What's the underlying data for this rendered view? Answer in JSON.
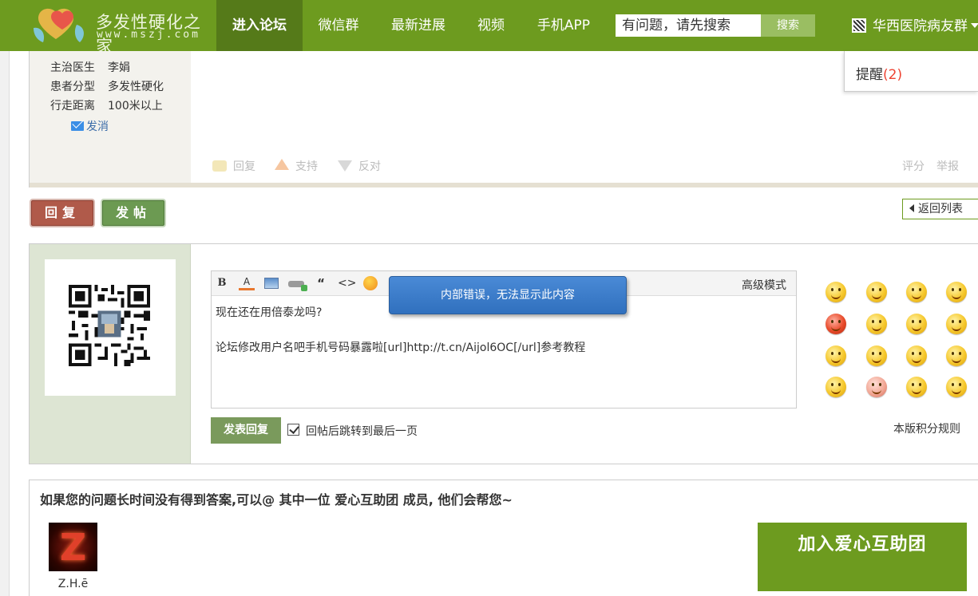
{
  "colors": {
    "brand_green": "#6d9b1f",
    "nav_active": "#557a19",
    "reply_red": "#b05a4a",
    "post_green": "#6c9a52",
    "error_blue": "#3a7bc8"
  },
  "header": {
    "logo_cn": "多发性硬化之家",
    "logo_url": "www.mszj.com",
    "nav": [
      "进入论坛",
      "微信群",
      "最新进展",
      "视频",
      "手机APP"
    ],
    "search": {
      "value": "有问题，请先搜索",
      "button": "搜索"
    },
    "group_link": "华西医院病友群",
    "reminder": {
      "label": "提醒",
      "count": "(2)"
    }
  },
  "post": {
    "profile": [
      {
        "label": "主治医生",
        "value": "李娟"
      },
      {
        "label": "患者分型",
        "value": "多发性硬化"
      },
      {
        "label": "行走距离",
        "value": "100米以上"
      }
    ],
    "send_message": "发消",
    "actions": {
      "reply": "回复",
      "support": "支持",
      "oppose": "反对",
      "rate": "评分",
      "report": "举报"
    }
  },
  "buttons": {
    "reply": "回复",
    "new_post": "发帖",
    "back_to_list": "返回列表"
  },
  "editor": {
    "advanced_mode": "高级模式",
    "lines": [
      "现在还在用倍泰龙吗?",
      "",
      "论坛修改用户名吧手机号码暴露啦[url]http://t.cn/Aijol6OC[/url]参考教程"
    ],
    "error_popup": "内部错误，无法显示此内容",
    "submit": "发表回复",
    "jump_option": "回帖后跳转到最后一页",
    "jump_checked": true,
    "rules_link": "本版积分规则"
  },
  "help": {
    "title": "如果您的问题长时间没有得到答案,可以@ 其中一位 爱心互助团 成员, 他们会帮您~",
    "members": [
      {
        "name": "Z.H.ē"
      }
    ],
    "join_button": "加入爱心互助团"
  }
}
